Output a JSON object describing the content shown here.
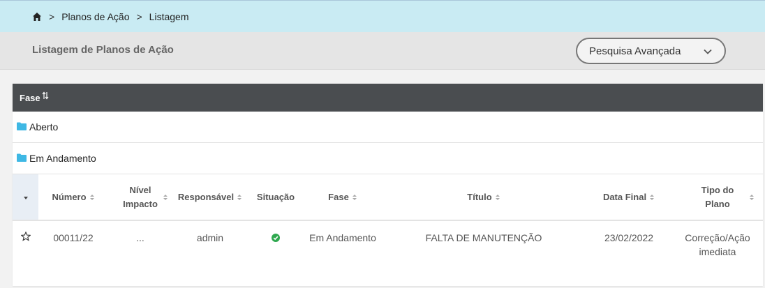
{
  "breadcrumb": {
    "items": [
      "Planos de Ação",
      "Listagem"
    ],
    "separator": ">"
  },
  "header": {
    "title": "Listagem de Planos de Ação",
    "advanced_search_label": "Pesquisa Avançada"
  },
  "grid": {
    "group_by_label": "Fase",
    "groups": [
      "Aberto",
      "Em Andamento"
    ],
    "columns": {
      "numero": "Número",
      "nivel_impacto": [
        "Nível",
        "Impacto"
      ],
      "responsavel": "Responsável",
      "situacao": "Situação",
      "fase": "Fase",
      "titulo": "Título",
      "data_final": "Data Final",
      "tipo_plano": [
        "Tipo do",
        "Plano"
      ]
    },
    "rows": [
      {
        "numero": "00011/22",
        "nivel_impacto": "...",
        "responsavel": "admin",
        "situacao_icon": "check-circle-icon",
        "fase": "Em Andamento",
        "titulo": "FALTA DE MANUTENÇÃO",
        "data_final": "23/02/2022",
        "tipo_plano": [
          "Correção/Ação",
          "imediata"
        ]
      }
    ]
  },
  "colors": {
    "breadcrumb_bg": "#c9ebf3",
    "group_header_bg": "#4a4d50",
    "folder": "#3fb8e4",
    "status_ok": "#2fa84f"
  }
}
